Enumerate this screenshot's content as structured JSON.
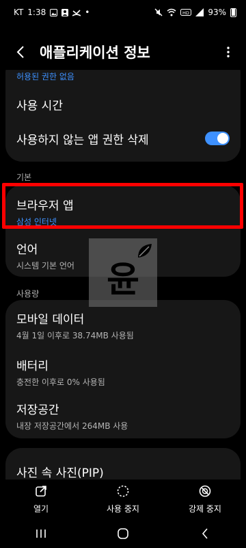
{
  "status_bar": {
    "carrier": "KT",
    "time": "1:38",
    "battery": "93%"
  },
  "header": {
    "title": "애플리케이션 정보"
  },
  "permissions_card": {
    "cut_text": "허용된 권한 없음",
    "usage_time": "사용 시간",
    "remove_unused": "사용하지 않는 앱 권한 삭제",
    "remove_unused_enabled": true
  },
  "sections": {
    "default": "기본",
    "usage": "사용량"
  },
  "default_card": {
    "browser_title": "브라우저 앱",
    "browser_value": "삼성 인터넷",
    "language_title": "언어",
    "language_value": "시스템 기본 언어"
  },
  "usage_card": {
    "mobile_data_title": "모바일 데이터",
    "mobile_data_value": "4월 1일 이후로 38.74MB 사용됨",
    "battery_title": "배터리",
    "battery_value": "충전한 이후로 0% 사용됨",
    "storage_title": "저장공간",
    "storage_value": "내장 저장공간에서 264MB 사용"
  },
  "pip_card": {
    "title": "사진 속 사진(PIP)"
  },
  "watermark": {
    "char": "윤"
  },
  "actions": [
    {
      "label": "열기",
      "icon": "open-in-new-icon"
    },
    {
      "label": "사용 중지",
      "icon": "disable-icon"
    },
    {
      "label": "강제 중지",
      "icon": "force-stop-icon"
    }
  ],
  "colors": {
    "accent": "#3e91ff",
    "card": "#171717",
    "highlight": "#ff0000"
  }
}
